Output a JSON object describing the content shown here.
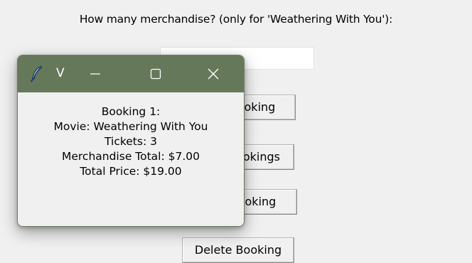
{
  "main": {
    "prompt_label": "How many merchandise? (only for 'Weathering With You'):",
    "merch_input_value": "",
    "buttons": {
      "add_label": "Add Booking",
      "view_label": "View Bookings",
      "edit_label": "Edit Booking",
      "delete_label": "Delete Booking"
    }
  },
  "popup": {
    "title": "V",
    "icons": {
      "app": "feather-icon",
      "minimize": "minimize-icon",
      "maximize": "maximize-icon",
      "close": "close-icon"
    },
    "lines": [
      "Booking 1:",
      "Movie: Weathering With You",
      "Tickets: 3",
      "Merchandise Total: $7.00",
      "Total Price: $19.00"
    ]
  },
  "colors": {
    "titlebar": "#66785a",
    "window_background": "#f0f0f0",
    "title_text": "#ffffff"
  }
}
